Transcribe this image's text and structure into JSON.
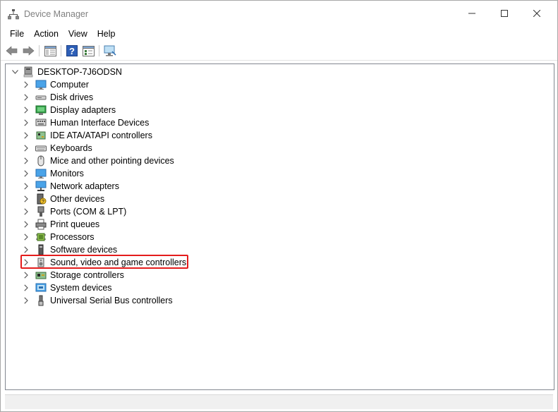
{
  "window": {
    "title": "Device Manager"
  },
  "menu": [
    "File",
    "Action",
    "View",
    "Help"
  ],
  "toolbar": {
    "icons": [
      "back-arrow-icon",
      "forward-arrow-icon",
      "show-hide-console-tree-icon",
      "help-icon",
      "properties-icon",
      "scan-hardware-icon"
    ]
  },
  "tree": {
    "root": "DESKTOP-7J6ODSN",
    "categories": [
      {
        "label": "Computer",
        "icon": "computer-icon"
      },
      {
        "label": "Disk drives",
        "icon": "disk-drive-icon"
      },
      {
        "label": "Display adapters",
        "icon": "display-adapter-icon"
      },
      {
        "label": "Human Interface Devices",
        "icon": "hid-icon"
      },
      {
        "label": "IDE ATA/ATAPI controllers",
        "icon": "ide-controller-icon"
      },
      {
        "label": "Keyboards",
        "icon": "keyboard-icon"
      },
      {
        "label": "Mice and other pointing devices",
        "icon": "mouse-icon"
      },
      {
        "label": "Monitors",
        "icon": "monitor-icon"
      },
      {
        "label": "Network adapters",
        "icon": "network-adapter-icon"
      },
      {
        "label": "Other devices",
        "icon": "other-devices-icon"
      },
      {
        "label": "Ports (COM & LPT)",
        "icon": "port-icon"
      },
      {
        "label": "Print queues",
        "icon": "printer-icon"
      },
      {
        "label": "Processors",
        "icon": "processor-icon"
      },
      {
        "label": "Software devices",
        "icon": "software-device-icon"
      },
      {
        "label": "Sound, video and game controllers",
        "icon": "speaker-icon"
      },
      {
        "label": "Storage controllers",
        "icon": "storage-controller-icon"
      },
      {
        "label": "System devices",
        "icon": "system-devices-icon"
      },
      {
        "label": "Universal Serial Bus controllers",
        "icon": "usb-icon"
      }
    ],
    "highlighted": "Sound, video and game controllers"
  },
  "colors": {
    "highlight_border": "#e41c1c",
    "title_text": "#808080",
    "tree_border": "#828790"
  }
}
